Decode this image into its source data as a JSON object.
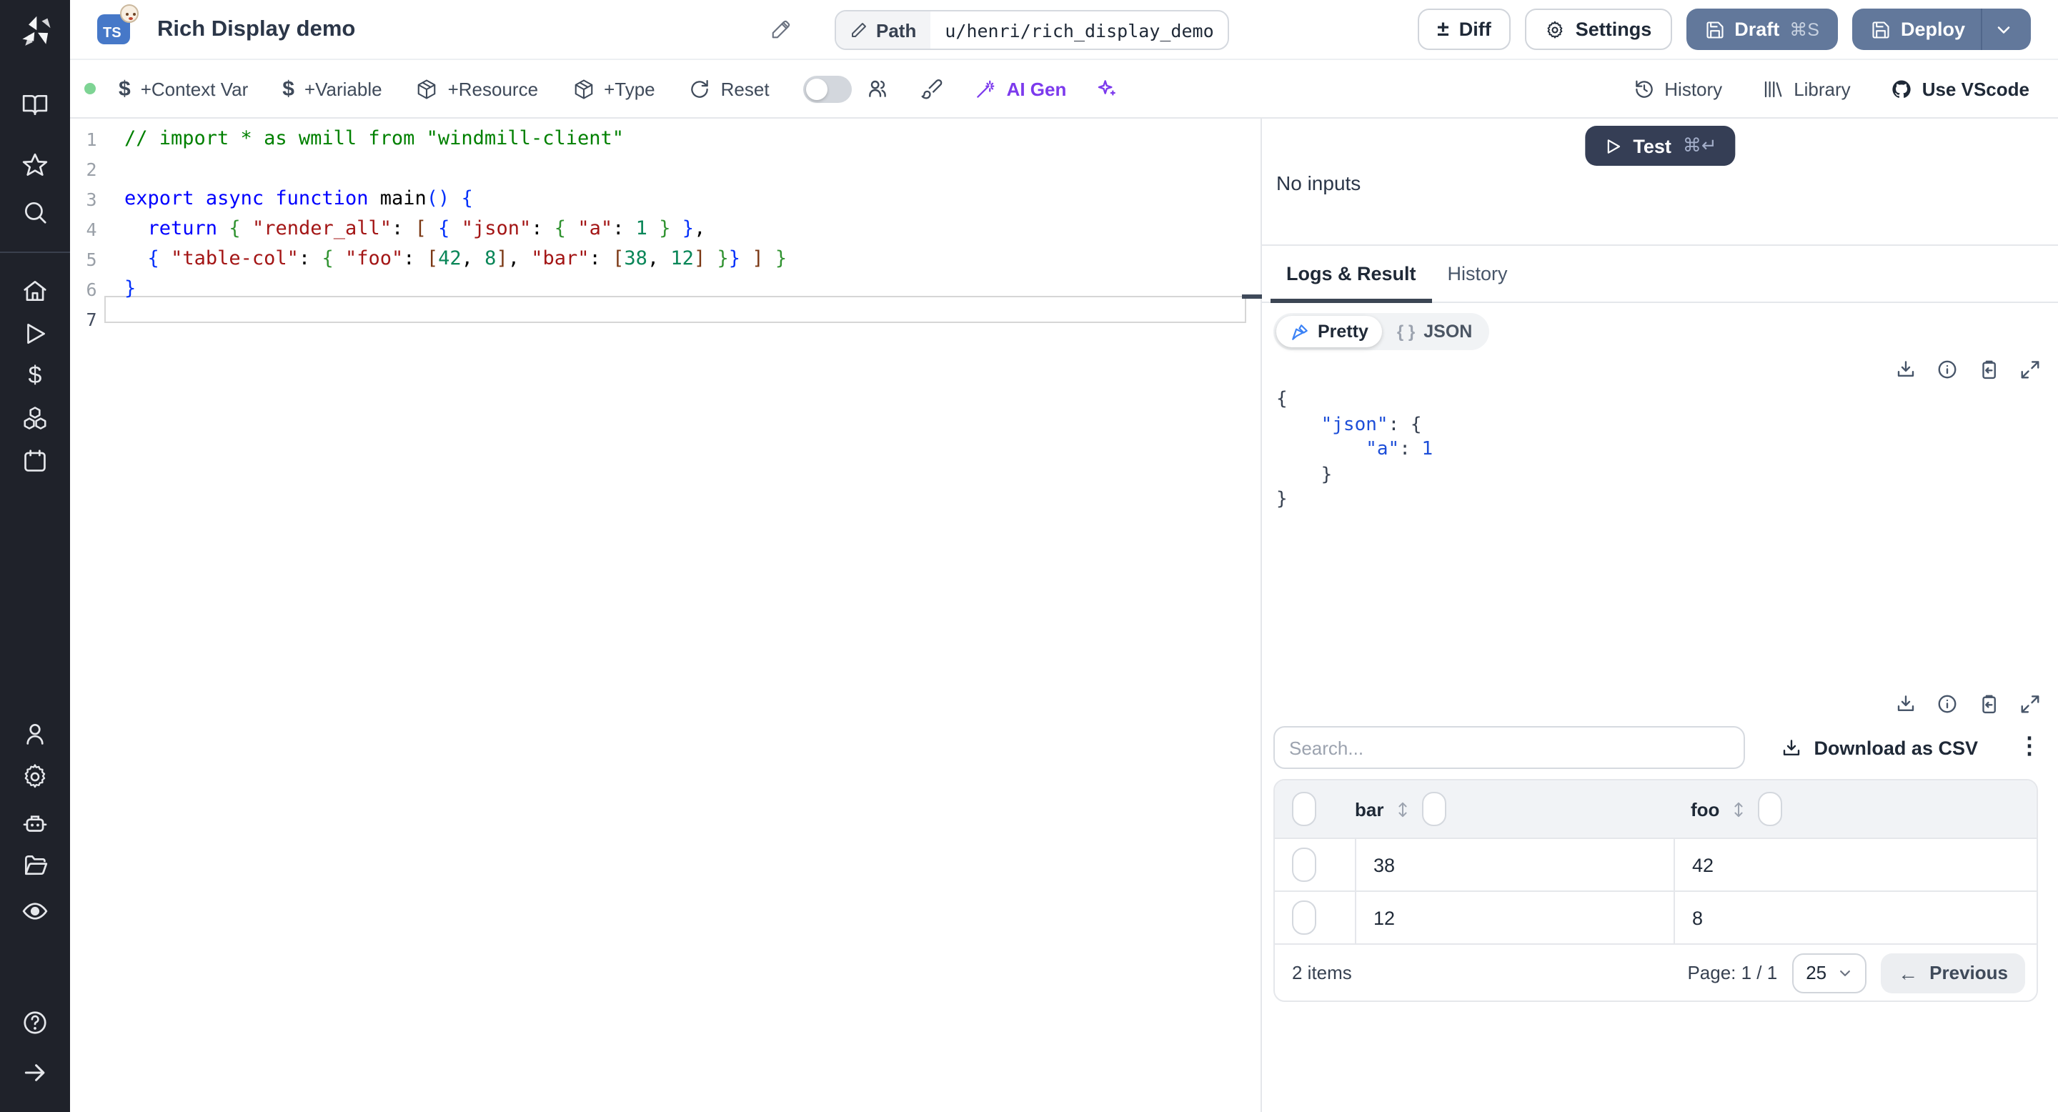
{
  "topbar": {
    "title": "Rich Display demo",
    "language_badge": "TS",
    "path_label": "Path",
    "path_value": "u/henri/rich_display_demo",
    "diff_label": "Diff",
    "settings_label": "Settings",
    "draft_label": "Draft",
    "draft_kbd": "⌘S",
    "deploy_label": "Deploy"
  },
  "toolbar": {
    "context_var": "+Context Var",
    "variable": "+Variable",
    "resource": "+Resource",
    "type": "+Type",
    "reset": "Reset",
    "ai_gen": "AI Gen",
    "history": "History",
    "library": "Library",
    "vscode": "Use VScode"
  },
  "sidebar": {
    "icons": [
      "book-icon",
      "star-icon",
      "search-icon",
      "home-icon",
      "play-icon",
      "dollar-icon",
      "boxes-icon",
      "calendar-icon",
      "user-icon",
      "gear-icon",
      "robot-icon",
      "folder-icon",
      "eye-icon",
      "help-icon",
      "arrow-right-icon"
    ]
  },
  "editor": {
    "line_numbers": [
      "1",
      "2",
      "3",
      "4",
      "5",
      "6",
      "7"
    ],
    "active_line": 7,
    "lines": [
      [
        {
          "t": "// import * as wmill from \"windmill-client\"",
          "c": "comment"
        }
      ],
      [],
      [
        {
          "t": "export",
          "c": "kw"
        },
        {
          "t": " ",
          "c": "plain"
        },
        {
          "t": "async",
          "c": "kw"
        },
        {
          "t": " ",
          "c": "plain"
        },
        {
          "t": "function",
          "c": "kw"
        },
        {
          "t": " main",
          "c": "plain"
        },
        {
          "t": "()",
          "c": "b1"
        },
        {
          "t": " ",
          "c": "plain"
        },
        {
          "t": "{",
          "c": "b1"
        }
      ],
      [
        {
          "t": "  ",
          "c": "plain"
        },
        {
          "t": "return",
          "c": "kw"
        },
        {
          "t": " ",
          "c": "plain"
        },
        {
          "t": "{",
          "c": "b2"
        },
        {
          "t": " ",
          "c": "plain"
        },
        {
          "t": "\"render_all\"",
          "c": "str"
        },
        {
          "t": ": ",
          "c": "plain"
        },
        {
          "t": "[",
          "c": "b3"
        },
        {
          "t": " ",
          "c": "plain"
        },
        {
          "t": "{",
          "c": "b1"
        },
        {
          "t": " ",
          "c": "plain"
        },
        {
          "t": "\"json\"",
          "c": "str"
        },
        {
          "t": ": ",
          "c": "plain"
        },
        {
          "t": "{",
          "c": "b2"
        },
        {
          "t": " ",
          "c": "plain"
        },
        {
          "t": "\"a\"",
          "c": "str"
        },
        {
          "t": ": ",
          "c": "plain"
        },
        {
          "t": "1",
          "c": "num"
        },
        {
          "t": " ",
          "c": "plain"
        },
        {
          "t": "}",
          "c": "b2"
        },
        {
          "t": " ",
          "c": "plain"
        },
        {
          "t": "}",
          "c": "b1"
        },
        {
          "t": ",",
          "c": "plain"
        }
      ],
      [
        {
          "t": "  ",
          "c": "plain"
        },
        {
          "t": "{",
          "c": "b1"
        },
        {
          "t": " ",
          "c": "plain"
        },
        {
          "t": "\"table-col\"",
          "c": "str"
        },
        {
          "t": ": ",
          "c": "plain"
        },
        {
          "t": "{",
          "c": "b2"
        },
        {
          "t": " ",
          "c": "plain"
        },
        {
          "t": "\"foo\"",
          "c": "str"
        },
        {
          "t": ": ",
          "c": "plain"
        },
        {
          "t": "[",
          "c": "b3"
        },
        {
          "t": "42",
          "c": "num"
        },
        {
          "t": ", ",
          "c": "plain"
        },
        {
          "t": "8",
          "c": "num"
        },
        {
          "t": "]",
          "c": "b3"
        },
        {
          "t": ", ",
          "c": "plain"
        },
        {
          "t": "\"bar\"",
          "c": "str"
        },
        {
          "t": ": ",
          "c": "plain"
        },
        {
          "t": "[",
          "c": "b3"
        },
        {
          "t": "38",
          "c": "num"
        },
        {
          "t": ", ",
          "c": "plain"
        },
        {
          "t": "12",
          "c": "num"
        },
        {
          "t": "]",
          "c": "b3"
        },
        {
          "t": " ",
          "c": "plain"
        },
        {
          "t": "}",
          "c": "b2"
        },
        {
          "t": "}",
          "c": "b1"
        },
        {
          "t": " ",
          "c": "plain"
        },
        {
          "t": "]",
          "c": "b3"
        },
        {
          "t": " ",
          "c": "plain"
        },
        {
          "t": "}",
          "c": "b2"
        }
      ],
      [
        {
          "t": "}",
          "c": "b1"
        }
      ],
      []
    ]
  },
  "preview": {
    "test_label": "Test",
    "test_kbd": "⌘↵",
    "no_inputs": "No inputs",
    "tabs": [
      {
        "label": "Logs & Result",
        "active": true
      },
      {
        "label": "History",
        "active": false
      }
    ],
    "pretty_label": "Pretty",
    "json_braces": "{ }",
    "json_label": "JSON",
    "result_lines": [
      [
        {
          "t": "{",
          "c": "brace"
        }
      ],
      [
        {
          "t": "    ",
          "c": "brace"
        },
        {
          "t": "\"json\"",
          "c": "key"
        },
        {
          "t": ": ",
          "c": "brace"
        },
        {
          "t": "{",
          "c": "brace"
        }
      ],
      [
        {
          "t": "        ",
          "c": "brace"
        },
        {
          "t": "\"a\"",
          "c": "key"
        },
        {
          "t": ": ",
          "c": "brace"
        },
        {
          "t": "1",
          "c": "val"
        }
      ],
      [
        {
          "t": "    ",
          "c": "brace"
        },
        {
          "t": "}",
          "c": "brace"
        }
      ],
      [
        {
          "t": "}",
          "c": "brace"
        }
      ]
    ],
    "search_placeholder": "Search...",
    "download_csv": "Download as CSV",
    "table": {
      "columns": [
        "bar",
        "foo"
      ],
      "rows": [
        [
          "38",
          "42"
        ],
        [
          "12",
          "8"
        ]
      ],
      "items_label": "2 items",
      "page_label": "Page: 1 / 1",
      "page_size": "25",
      "previous_label": "Previous"
    }
  },
  "colors": {
    "sidebar_bg": "#1F222A",
    "slate_button": "#62789B",
    "test_button": "#353E55",
    "ai_purple": "#7C3AED",
    "status_dot_green": "#7ED494",
    "tab_underline": "#3C4654",
    "ts_badge_blue": "#4678C8",
    "code_keyword": "#0000FF",
    "code_string": "#A31515",
    "code_number": "#098658",
    "code_comment": "#008000",
    "bracket_blue": "#0431FA",
    "bracket_green": "#319331",
    "bracket_brown": "#7B3814",
    "json_key_blue": "#1D4ED8"
  }
}
